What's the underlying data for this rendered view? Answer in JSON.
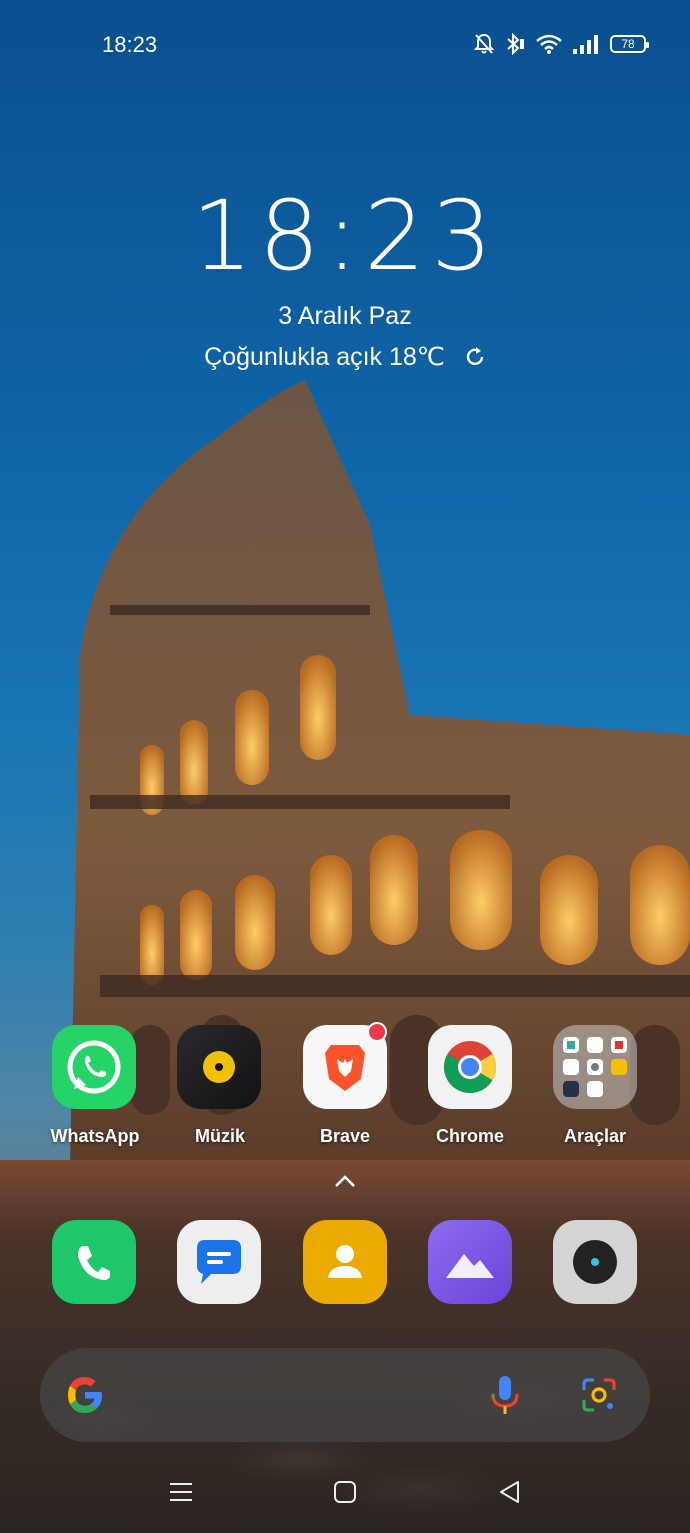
{
  "status_bar": {
    "time": "18:23",
    "battery": "78",
    "icons": [
      "bell-off-icon",
      "bluetooth-icon",
      "wifi-icon",
      "signal-icon",
      "battery-icon"
    ]
  },
  "clock_widget": {
    "time": "18:23",
    "date": "3 Aralık Paz",
    "weather": "Çoğunlukla açık 18℃"
  },
  "home_apps": [
    {
      "label": "WhatsApp",
      "icon": "whatsapp-icon"
    },
    {
      "label": "Müzik",
      "icon": "music-icon"
    },
    {
      "label": "Brave",
      "icon": "brave-icon",
      "badge": true
    },
    {
      "label": "Chrome",
      "icon": "chrome-icon"
    },
    {
      "label": "Araçlar",
      "icon": "folder-icon"
    }
  ],
  "dock": [
    {
      "icon": "phone-icon"
    },
    {
      "icon": "messages-icon"
    },
    {
      "icon": "contacts-icon"
    },
    {
      "icon": "gallery-icon"
    },
    {
      "icon": "camera-icon"
    }
  ],
  "search_bar": {
    "icons": [
      "google-icon",
      "microphone-icon",
      "lens-icon"
    ]
  },
  "nav_bar": {
    "buttons": [
      "menu-button",
      "home-button",
      "back-button"
    ]
  },
  "colors": {
    "whatsapp": "#25d366",
    "brave": "#fb542b",
    "gallery": "#7a5ae0",
    "contacts": "#f0b000",
    "badge": "#e83a4a"
  }
}
